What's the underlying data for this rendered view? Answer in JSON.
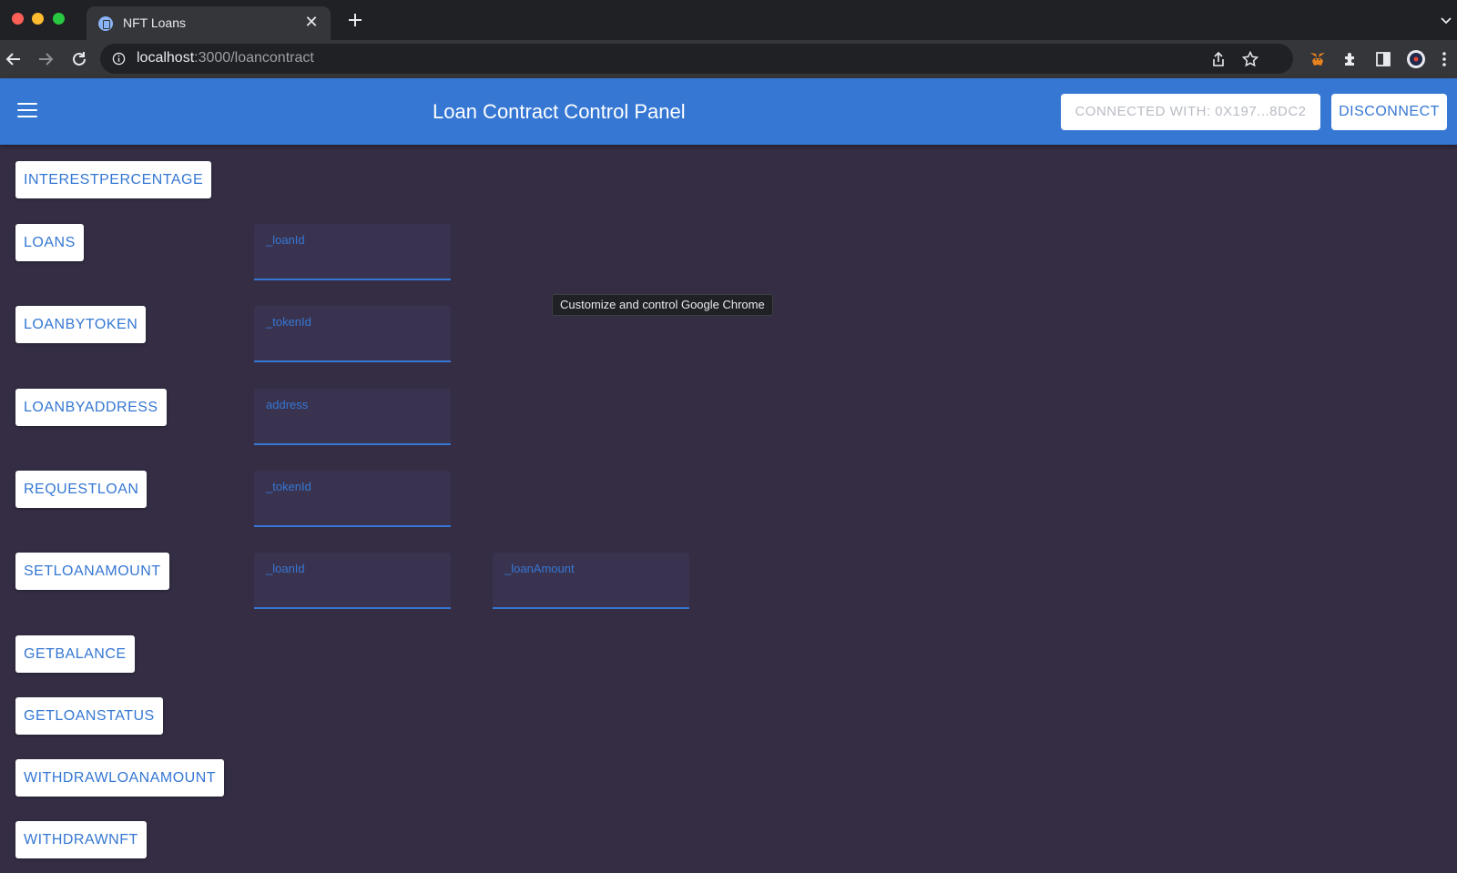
{
  "browser": {
    "tab_title": "NFT Loans",
    "url_host": "localhost",
    "url_path": ":3000/loancontract",
    "tooltip": "Customize and control Google Chrome"
  },
  "appbar": {
    "title": "Loan Contract Control Panel",
    "connected_label": "CONNECTED WITH: 0X197...8DC2",
    "disconnect_label": "DISCONNECT"
  },
  "functions": [
    {
      "label": "INTERESTPERCENTAGE",
      "params": []
    },
    {
      "label": "LOANS",
      "params": [
        "_loanId"
      ]
    },
    {
      "label": "LOANBYTOKEN",
      "params": [
        "_tokenId"
      ]
    },
    {
      "label": "LOANBYADDRESS",
      "params": [
        "address"
      ]
    },
    {
      "label": "REQUESTLOAN",
      "params": [
        "_tokenId"
      ]
    },
    {
      "label": "SETLOANAMOUNT",
      "params": [
        "_loanId",
        "_loanAmount"
      ]
    },
    {
      "label": "GETBALANCE",
      "params": []
    },
    {
      "label": "GETLOANSTATUS",
      "params": []
    },
    {
      "label": "WITHDRAWLOANAMOUNT",
      "params": []
    },
    {
      "label": "WITHDRAWNFT",
      "params": []
    }
  ]
}
